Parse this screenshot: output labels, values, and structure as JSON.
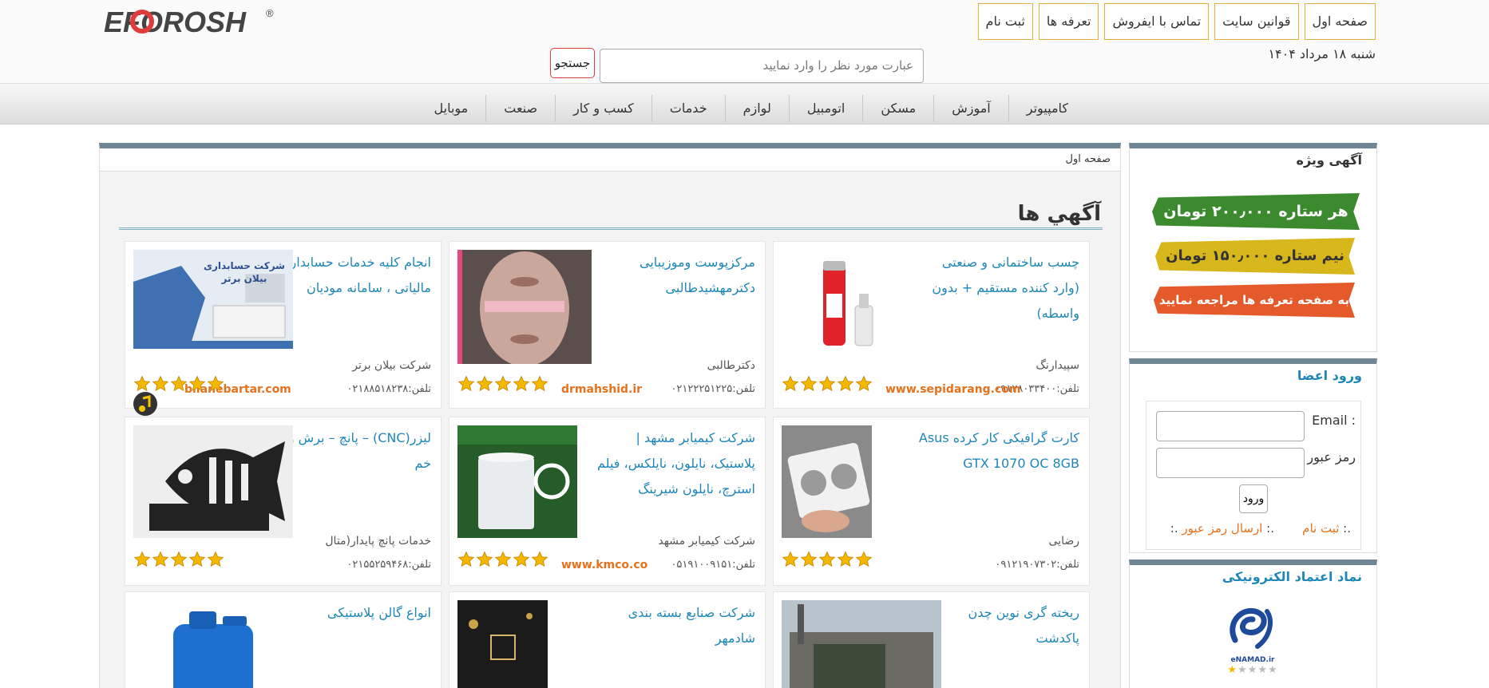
{
  "brand": {
    "name": "EFOROSH",
    "reg": "®"
  },
  "nav_top": [
    "صفحه اول",
    "قوانين سايت",
    "تماس با ايفروش",
    "تعرفه ها",
    "ثبت نام"
  ],
  "date": "شنبه ۱۸ مرداد ۱۴۰۴",
  "search": {
    "placeholder": "عبارت مورد نظر را وارد نمایید",
    "button": "جستجو"
  },
  "categories": [
    "کامپیوتر",
    "آموزش",
    "مسکن",
    "اتومبیل",
    "لوازم",
    "خدمات",
    "کسب و کار",
    "صنعت",
    "موبایل"
  ],
  "breadcrumb": "صفحه اول",
  "section_title": "آگهي ها",
  "cards": [
    {
      "title": "چسب ساختمانی و صنعتی (وارد کننده مستقیم + بدون واسطه)",
      "company": "سپیدارنگ",
      "phone": "تلفن:۰۹۱۲۸۰۳۳۴۰۰",
      "site": "www.sepidarang.com",
      "stars": 5
    },
    {
      "title": "مرکزپوست وموزیبایی دکترمهشیدطالبی",
      "company": "دکترطالبی",
      "phone": "تلفن:۰۲۱۲۲۲۵۱۲۲۵",
      "site": "drmahshid.ir",
      "stars": 5
    },
    {
      "title": "انجام کلیه خدمات حسابداری و مالیاتی ، سامانه مودیان",
      "company": "شرکت بیلان برتر",
      "phone": "تلفن:۰۲۱۸۸۵۱۸۲۳۸",
      "site": "bilanebartar.com",
      "stars": 5,
      "image_caption": "شرکت حسابداری بیلان برتر"
    },
    {
      "title": "کارت گرافیکی کار کرده Asus GTX 1070 OC 8GB",
      "company": "رضایی",
      "phone": "تلفن:۰۹۱۲۱۹۰۷۳۰۲",
      "site": "",
      "stars": 5
    },
    {
      "title": "شرکت کیمیابر مشهد | پلاستیک، نایلون، نایلکس، فیلم استرچ، نایلون شیرینگ",
      "company": "شرکت کیمیابر مشهد",
      "phone": "تلفن:۰۵۱۹۱۰۰۹۱۵۱",
      "site": "www.kmco.co",
      "stars": 5
    },
    {
      "title": "لیزر(CNC) – پانچ – برش و خم",
      "company": "خدمات پانچ پایدار(متال",
      "phone": "تلفن:۰۲۱۵۵۲۵۹۴۶۸",
      "site": "",
      "stars": 5
    },
    {
      "title": "ریخته گری نوین چدن پاکدشت",
      "company": "",
      "phone": "",
      "site": "",
      "stars": 0
    },
    {
      "title": "شرکت صنایع بسته بندی شادمهر",
      "company": "",
      "phone": "",
      "site": "",
      "stars": 0
    },
    {
      "title": "انواع گالن پلاستیکی",
      "company": "",
      "phone": "",
      "site": "",
      "stars": 0
    }
  ],
  "sidebar": {
    "featured_title": "آگهی ویژه",
    "banner1": "هر ستاره ۲۰۰٫۰۰۰ تومان",
    "banner2": "نیم ستاره ۱۵۰٫۰۰۰ تومان",
    "banner3": "به صفحه تعرفه ها مراجعه نمایید",
    "login_title": "ورود اعضا",
    "email_label": "Email :",
    "password_label": "رمز عبور :",
    "login_button": "ورود",
    "register_link": "ثبت نام",
    "forgot_link": "ارسال رمز عبور",
    "link_sep": ".:",
    "trust_title": "نماد اعتماد الکترونیکی",
    "enamad": "eNAMAD.ir"
  },
  "colors": {
    "accent": "#1e87b8",
    "orange": "#e8711b",
    "panel_top": "#6f8794",
    "star": "#f5b800"
  }
}
